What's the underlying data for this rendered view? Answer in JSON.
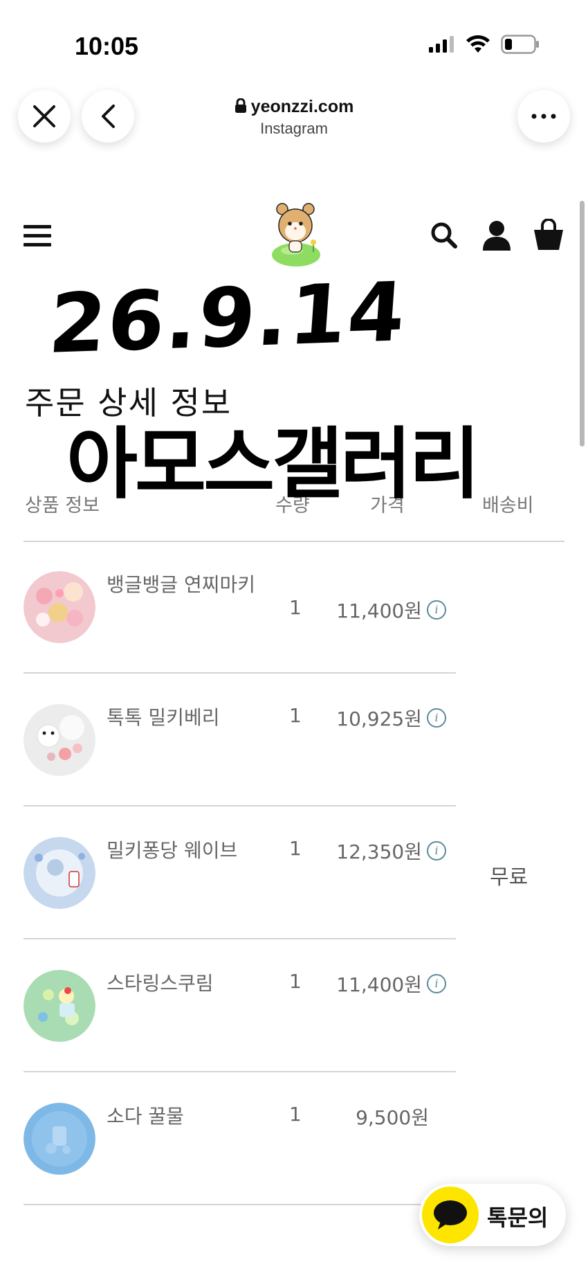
{
  "status_bar": {
    "time": "10:05"
  },
  "browser": {
    "domain": "yeonzzi.com",
    "subtitle": "Instagram"
  },
  "handwritten": {
    "date": "26.9.14",
    "shop": "아모스갤러리"
  },
  "page": {
    "title": "주문 상세 정보"
  },
  "table": {
    "headers": {
      "product": "상품 정보",
      "qty": "수량",
      "price": "가격",
      "shipping": "배송비"
    },
    "rows": [
      {
        "name": "뱅글뱅글 연찌마키",
        "qty": "1",
        "price": "11,400원",
        "info": "i"
      },
      {
        "name": "톡톡 밀키베리",
        "qty": "1",
        "price": "10,925원",
        "info": "i"
      },
      {
        "name": "밀키퐁당 웨이브",
        "qty": "1",
        "price": "12,350원",
        "info": "i"
      },
      {
        "name": "스타링스쿠림",
        "qty": "1",
        "price": "11,400원",
        "info": "i"
      },
      {
        "name": "소다 꿀물",
        "qty": "1",
        "price": "9,500원"
      }
    ],
    "shipping_value": "무료"
  },
  "chat": {
    "label": "톡문의"
  },
  "icons": [
    "signal-icon",
    "wifi-icon",
    "battery-icon",
    "close-icon",
    "back-icon",
    "lock-icon",
    "more-icon",
    "menu-icon",
    "hamster-logo-icon",
    "search-icon",
    "user-icon",
    "bag-icon",
    "info-icon",
    "chat-bubble-icon"
  ]
}
